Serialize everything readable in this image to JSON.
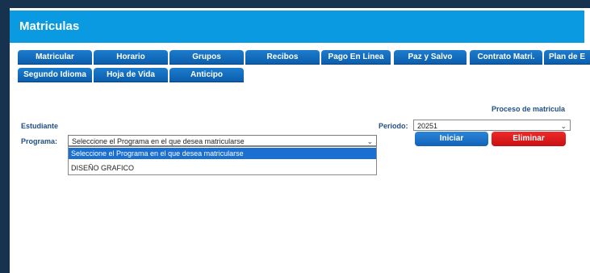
{
  "page": {
    "title": "Matriculas"
  },
  "nav": {
    "tabs": [
      {
        "label": "Matricular"
      },
      {
        "label": "Horario"
      },
      {
        "label": "Grupos"
      },
      {
        "label": "Recibos"
      },
      {
        "label": "Pago En Linea"
      },
      {
        "label": "Paz y Salvo"
      },
      {
        "label": "Contrato Matri."
      },
      {
        "label": "Plan de E"
      },
      {
        "label": "Segundo Idioma"
      },
      {
        "label": "Hoja de Vida"
      },
      {
        "label": "Anticipo"
      }
    ]
  },
  "form": {
    "section_label": "Proceso de matricula",
    "student_label": "Estudiante",
    "program_label": "Programa:",
    "program_selected": "Seleccione el Programa en el que desea matricularse",
    "program_options": [
      "Seleccione el Programa en el que desea matricularse",
      "DISEÑO GRAFICO"
    ],
    "period_label": "Periodo:",
    "period_value": "20251",
    "start_button": "Iniciar",
    "delete_button": "Eliminar"
  },
  "colors": {
    "header": "#0a9ae1",
    "tab": "#0b5fae",
    "label": "#1f4f86",
    "start_button": "#1d72c9",
    "delete_button": "#d81a1a",
    "selected_option": "#1a6fd1"
  }
}
